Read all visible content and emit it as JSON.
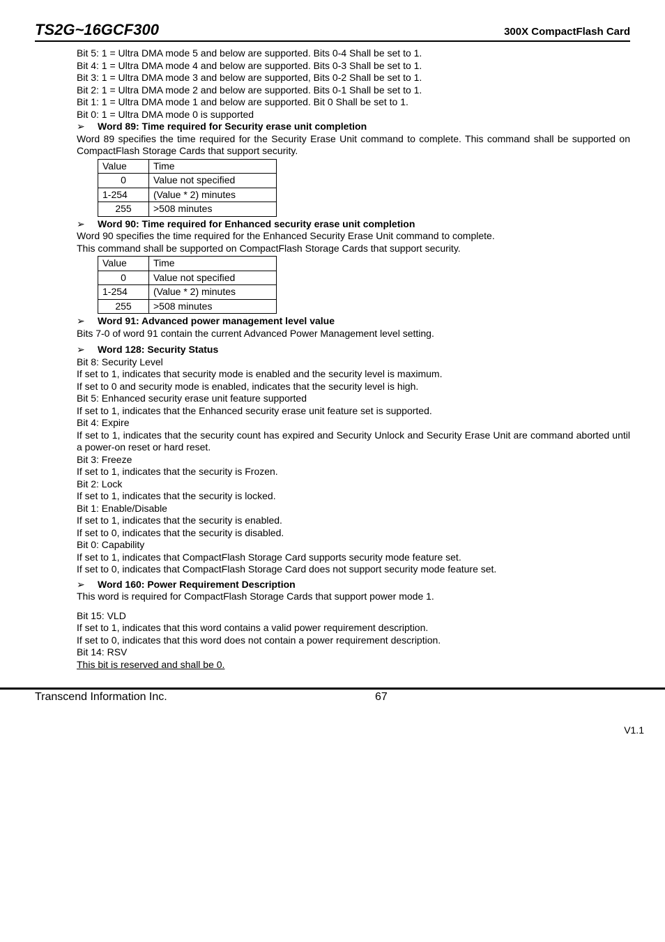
{
  "header": {
    "title_left": "TS2G~16GCF300",
    "title_right": "300X CompactFlash Card"
  },
  "body": {
    "bits_intro": [
      "Bit 5: 1 = Ultra DMA mode 5 and below are supported. Bits 0-4 Shall be set to 1.",
      "Bit 4: 1 = Ultra DMA mode 4 and below are supported. Bits 0-3 Shall be set to 1.",
      "Bit 3: 1 = Ultra DMA mode 3 and below are supported, Bits 0-2 Shall be set to 1.",
      "Bit 2: 1 = Ultra DMA mode 2 and below are supported. Bits 0-1 Shall be set to 1.",
      "Bit 1: 1 = Ultra DMA mode 1 and below are supported. Bit 0 Shall be set to 1.",
      "Bit 0: 1 = Ultra DMA mode 0 is supported"
    ],
    "word89": {
      "title": "Word 89: Time required for Security erase unit completion",
      "desc": "Word 89 specifies the time required for the Security Erase Unit command to complete. This command shall be supported on CompactFlash Storage Cards that support security.",
      "th1": "Value",
      "th2": "Time",
      "rows": [
        {
          "v": "0",
          "t": "Value not specified"
        },
        {
          "v": "1-254",
          "t": "(Value * 2) minutes"
        },
        {
          "v": "255",
          "t": ">508 minutes"
        }
      ]
    },
    "word90": {
      "title": "Word 90: Time required for Enhanced security erase unit completion",
      "desc1": "Word 90 specifies the time required for the Enhanced Security Erase Unit command to complete.",
      "desc2": "This command shall be supported on CompactFlash Storage Cards that support security.",
      "th1": "Value",
      "th2": "Time",
      "rows": [
        {
          "v": "0",
          "t": "Value not specified"
        },
        {
          "v": "1-254",
          "t": "(Value * 2) minutes"
        },
        {
          "v": "255",
          "t": ">508 minutes"
        }
      ]
    },
    "word91": {
      "title": "Word 91: Advanced power management level value",
      "desc": "Bits 7-0 of word 91 contain the current Advanced Power Management level setting."
    },
    "word128": {
      "title": "Word 128: Security Status",
      "lines": [
        "Bit 8: Security Level",
        "If set to 1, indicates that security mode is enabled and the security level is maximum.",
        "If set to 0 and security mode is enabled, indicates that the security level is high.",
        "Bit 5: Enhanced security erase unit feature supported",
        "If set to 1, indicates that the Enhanced security erase unit feature set is supported.",
        "Bit 4: Expire",
        "If set to 1, indicates that the security count has expired and Security Unlock and Security Erase Unit are command aborted until a power-on reset or hard reset.",
        "Bit 3: Freeze",
        "If set to 1, indicates that the security is Frozen.",
        "Bit 2: Lock",
        "If set to 1, indicates that the security is locked.",
        "Bit 1: Enable/Disable",
        "If set to 1, indicates that the security is enabled.",
        "If set to 0, indicates that the security is disabled.",
        "Bit 0: Capability",
        "If set to 1, indicates that CompactFlash Storage Card supports security mode feature set.",
        "If set to 0, indicates that CompactFlash Storage Card does not support security mode feature set."
      ]
    },
    "word160": {
      "title": "Word 160: Power Requirement Description",
      "desc": "This word is required for CompactFlash Storage Cards that support power mode 1.",
      "lines": [
        "Bit 15: VLD",
        "If set to 1, indicates that this word contains a valid power requirement description.",
        "If set to 0, indicates that this word does not contain a power requirement description.",
        "Bit 14: RSV"
      ],
      "last_line": "This bit is reserved and shall be 0."
    }
  },
  "footer": {
    "company": "Transcend Information Inc.",
    "page_num": "67",
    "version": "V1.1"
  }
}
